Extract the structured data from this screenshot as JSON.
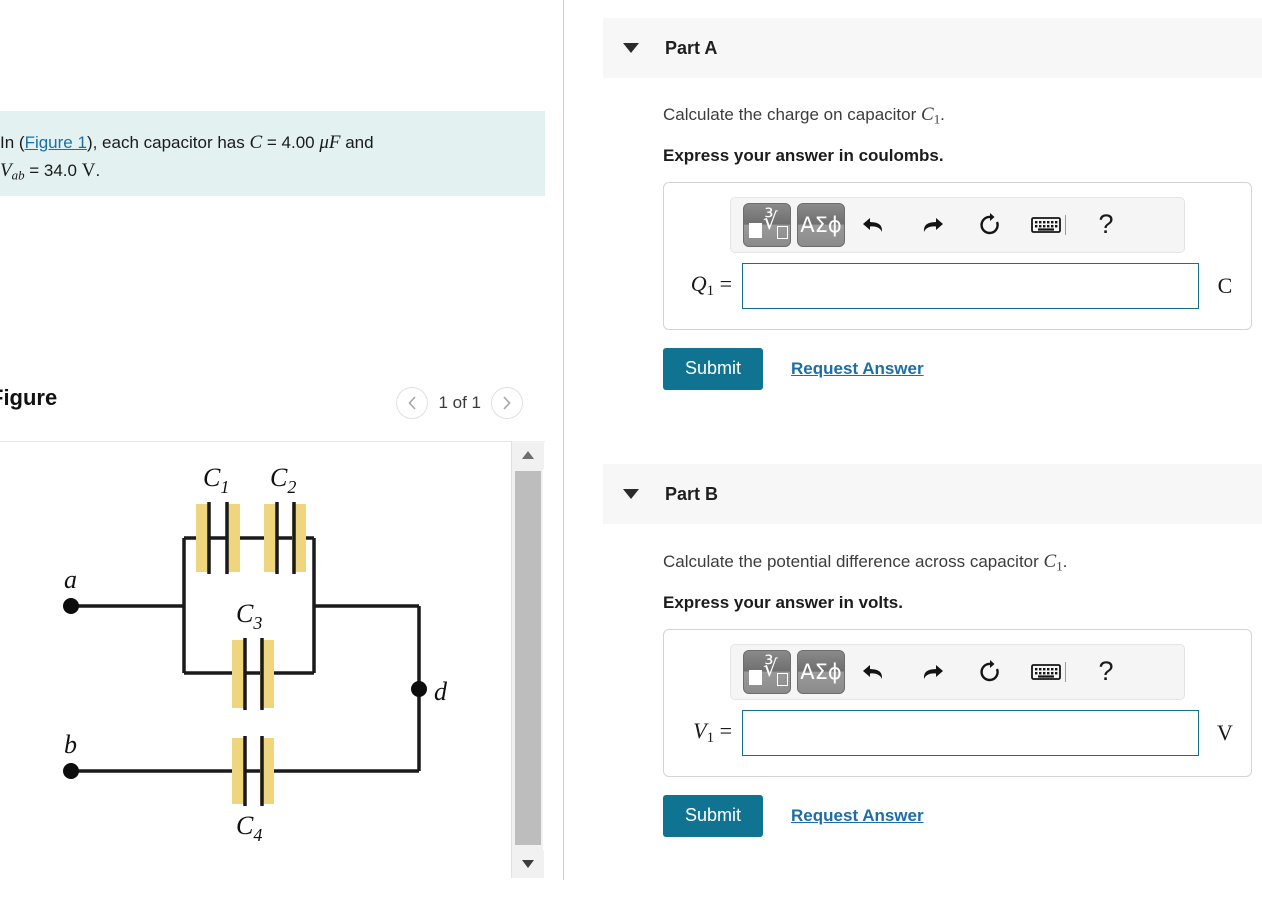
{
  "question": {
    "intro_pre": "In (",
    "figure_link": "Figure 1",
    "intro_post": "), each capacitor has ",
    "cap_symbol": "C",
    "cap_value": " = 4.00 ",
    "cap_unit": "μF",
    "and_word": " and",
    "v_symbol": "V",
    "v_sub": "ab",
    "v_value": " = 34.0 ",
    "v_unit": "V",
    "period": "."
  },
  "figure_panel": {
    "title": "Figure",
    "pager_label": "1 of 1",
    "prev_icon": "chevron-left-icon",
    "next_icon": "chevron-right-icon",
    "scroll_up_icon": "triangle-up-icon",
    "scroll_down_icon": "triangle-down-icon"
  },
  "circuit": {
    "node_a": "a",
    "node_b": "b",
    "node_d": "d",
    "c1": "C",
    "c1_sub": "1",
    "c2": "C",
    "c2_sub": "2",
    "c3": "C",
    "c3_sub": "3",
    "c4": "C",
    "c4_sub": "4",
    "plate_color": "#efd67e",
    "wire_color": "#1a1a1a"
  },
  "toolbar": {
    "math_template_icon": "math-template-icon",
    "greek_label": "ΑΣϕ",
    "undo_icon": "↶",
    "redo_icon": "↷",
    "reset_icon": "↻",
    "keyboard_icon": "⌨",
    "help_icon": "?"
  },
  "parts": [
    {
      "id": "part-a",
      "title": "Part A",
      "prompt_pre": "Calculate the charge on capacitor ",
      "prompt_symbol": "C",
      "prompt_sub": "1",
      "prompt_post": ".",
      "units_instruction": "Express your answer in coulombs.",
      "answer_symbol": "Q",
      "answer_sub": "1",
      "answer_equals": " =",
      "answer_value": "",
      "answer_placeholder": "",
      "unit_label": "C",
      "submit_label": "Submit",
      "request_label": "Request Answer"
    },
    {
      "id": "part-b",
      "title": "Part B",
      "prompt_pre": "Calculate the potential difference across capacitor ",
      "prompt_symbol": "C",
      "prompt_sub": "1",
      "prompt_post": ".",
      "units_instruction": "Express your answer in volts.",
      "answer_symbol": "V",
      "answer_sub": "1",
      "answer_equals": " =",
      "answer_value": "",
      "answer_placeholder": "",
      "unit_label": "V",
      "submit_label": "Submit",
      "request_label": "Request Answer"
    }
  ],
  "colors": {
    "accent": "#0f7391",
    "link": "#1c6ea4",
    "question_bg": "#e3f2f0",
    "header_bg": "#f7f7f7",
    "input_border": "#15708c"
  }
}
